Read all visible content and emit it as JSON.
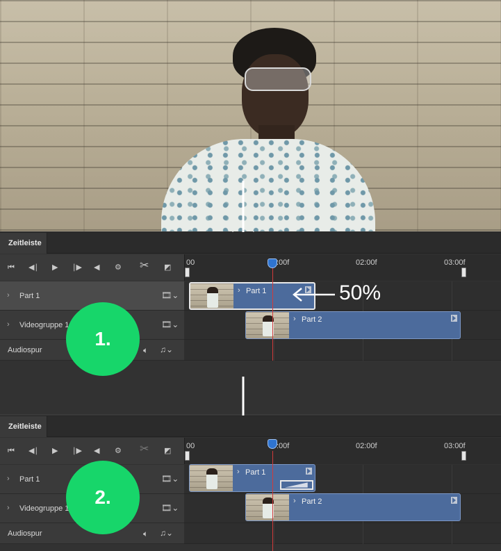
{
  "panel1": {
    "tab": "Zeitleiste",
    "ruler": [
      "00",
      ":00f",
      "02:00f",
      "03:00f"
    ],
    "tracks": [
      "Part 1",
      "Videogruppe 1",
      "Audiospur"
    ],
    "clips": [
      "Part 1",
      "Part 2"
    ],
    "badge": "1.",
    "speed": "50%"
  },
  "panel2": {
    "tab": "Zeitleiste",
    "ruler": [
      "00",
      ":00f",
      "02:00f",
      "03:00f"
    ],
    "tracks": [
      "Part 1",
      "Videogruppe 1",
      "Audiospur"
    ],
    "clips": [
      "Part 1",
      "Part 2"
    ],
    "badge": "2."
  },
  "icons": [
    "skip-back-icon",
    "step-back-icon",
    "play-icon",
    "step-forward-icon",
    "volume-icon",
    "gear-icon",
    "scissors-icon",
    "transition-icon",
    "film-icon",
    "music-note-icon"
  ],
  "colors": {
    "clip": "#4c6b9c",
    "badge": "#17d66a",
    "playhead": "#2f74d0",
    "playhead_line": "#d23a3a"
  }
}
